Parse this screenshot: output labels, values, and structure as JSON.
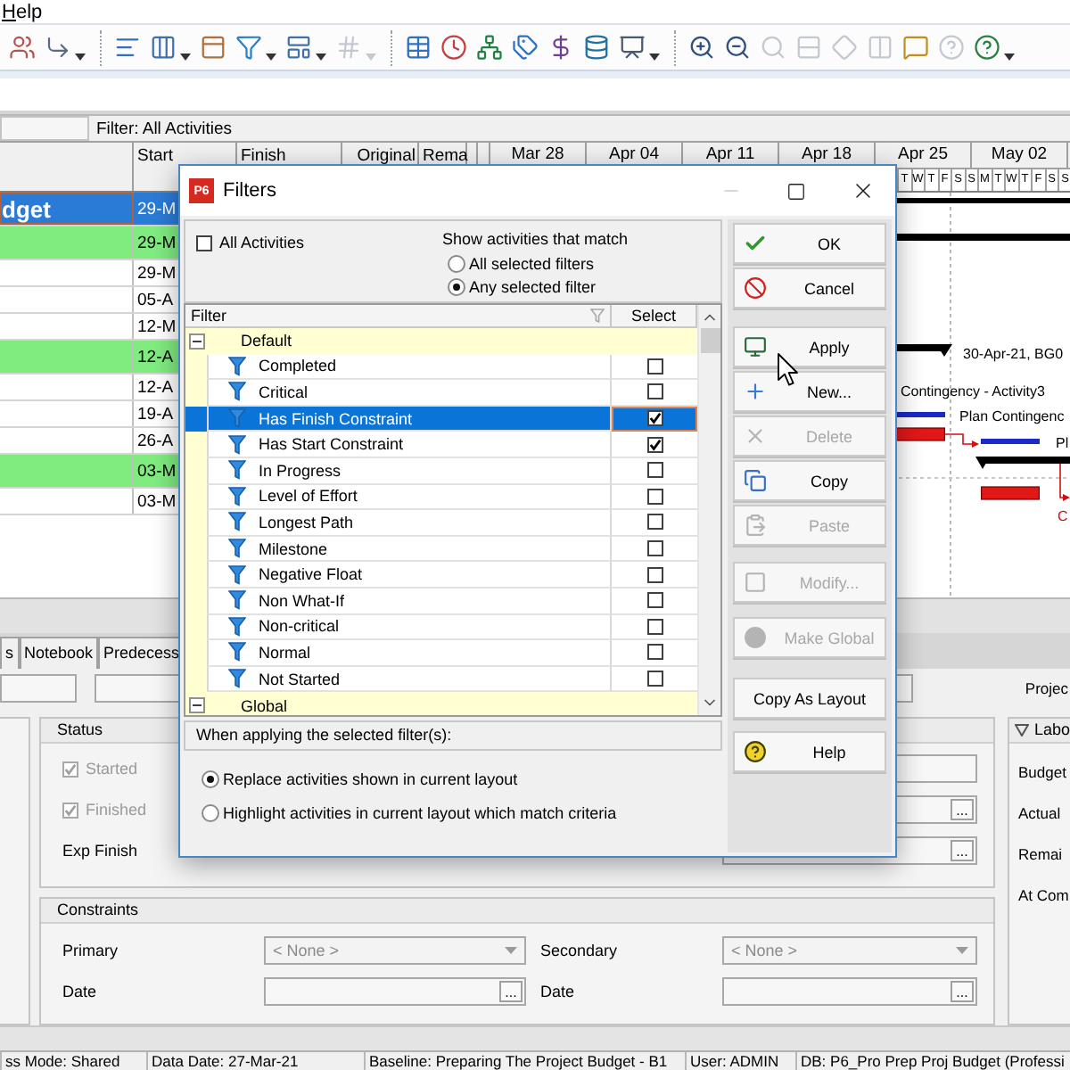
{
  "menu_bar": {
    "items": [
      {
        "label": "Help"
      }
    ]
  },
  "toolbar": {
    "items": [
      {
        "kind": "button",
        "disabled": false,
        "dropdown": false
      },
      {
        "kind": "button",
        "disabled": false,
        "dropdown": true
      },
      {
        "kind": "separator"
      },
      {
        "kind": "button",
        "disabled": false,
        "dropdown": false
      },
      {
        "kind": "button",
        "disabled": false,
        "dropdown": true
      },
      {
        "kind": "button",
        "disabled": false,
        "dropdown": false
      },
      {
        "kind": "button",
        "disabled": false,
        "dropdown": true
      },
      {
        "kind": "button",
        "disabled": false,
        "dropdown": true
      },
      {
        "kind": "button",
        "disabled": true,
        "dropdown": true
      },
      {
        "kind": "separator"
      },
      {
        "kind": "button",
        "disabled": false,
        "dropdown": false
      },
      {
        "kind": "button",
        "disabled": false,
        "dropdown": false
      },
      {
        "kind": "button",
        "disabled": false,
        "dropdown": false
      },
      {
        "kind": "button",
        "disabled": false,
        "dropdown": false
      },
      {
        "kind": "button",
        "disabled": false,
        "dropdown": false
      },
      {
        "kind": "button",
        "disabled": false,
        "dropdown": false
      },
      {
        "kind": "button",
        "disabled": false,
        "dropdown": true
      },
      {
        "kind": "separator"
      },
      {
        "kind": "button",
        "disabled": false,
        "dropdown": false
      },
      {
        "kind": "button",
        "disabled": false,
        "dropdown": false
      },
      {
        "kind": "button",
        "disabled": true,
        "dropdown": false
      },
      {
        "kind": "button",
        "disabled": true,
        "dropdown": false
      },
      {
        "kind": "button",
        "disabled": true,
        "dropdown": false
      },
      {
        "kind": "button",
        "disabled": true,
        "dropdown": false
      },
      {
        "kind": "button",
        "disabled": false,
        "dropdown": false
      },
      {
        "kind": "button",
        "disabled": true,
        "dropdown": false
      },
      {
        "kind": "button",
        "disabled": false,
        "dropdown": true
      }
    ]
  },
  "filter_bar": {
    "label": "Filter: All Activities"
  },
  "activity_table": {
    "columns": [
      {
        "label": "Start"
      },
      {
        "label": "Finish"
      },
      {
        "label": "Original"
      },
      {
        "label": "Rema"
      }
    ],
    "timescale": {
      "weeks": [
        "Mar 28",
        "Apr 04",
        "Apr 11",
        "Apr 18",
        "Apr 25",
        "May 02"
      ],
      "days": [
        "T",
        "W",
        "T",
        "F",
        "S",
        "S",
        "M",
        "T",
        "W",
        "T",
        "F",
        "S",
        "S"
      ]
    },
    "rows": [
      {
        "kind": "project",
        "name": "dget",
        "start": "29-M",
        "selected": true
      },
      {
        "kind": "wbs",
        "start": "29-M",
        "selected": false
      },
      {
        "kind": "activity",
        "start": "29-M",
        "selected": false
      },
      {
        "kind": "activity",
        "start": "05-A",
        "selected": false
      },
      {
        "kind": "activity",
        "start": "12-M",
        "selected": false
      },
      {
        "kind": "wbs",
        "start": "12-A",
        "selected": false
      },
      {
        "kind": "activity",
        "start": "12-A",
        "selected": false
      },
      {
        "kind": "activity",
        "start": "19-A",
        "selected": false
      },
      {
        "kind": "activity",
        "start": "26-A",
        "selected": false
      },
      {
        "kind": "wbs",
        "start": "03-M",
        "selected": false
      },
      {
        "kind": "activity",
        "start": "03-M",
        "selected": false
      }
    ]
  },
  "gantt": {
    "labels": [
      {
        "text": "30-Apr-21, BG0",
        "critical": false
      },
      {
        "text": "Contingency - Activity3",
        "critical": false
      },
      {
        "text": "Plan Contingenc",
        "critical": false
      },
      {
        "text": "Pl",
        "critical": false
      },
      {
        "text": "C",
        "critical": true
      }
    ]
  },
  "filters_dialog": {
    "icon_text": "P6",
    "title": "Filters",
    "all_activities": {
      "label": "All Activities",
      "checked": false
    },
    "match": {
      "label": "Show activities that match",
      "options": [
        {
          "label": "All selected filters",
          "selected": false
        },
        {
          "label": "Any selected filter",
          "selected": true
        }
      ]
    },
    "filter_table": {
      "columns": [
        {
          "label": "Filter"
        },
        {
          "label": "Select"
        }
      ],
      "groups": [
        {
          "label": "Default",
          "expanded": true,
          "children": [
            {
              "label": "Completed",
              "checked": false,
              "selected": false
            },
            {
              "label": "Critical",
              "checked": false,
              "selected": false
            },
            {
              "label": "Has Finish Constraint",
              "checked": true,
              "selected": true
            },
            {
              "label": "Has Start Constraint",
              "checked": true,
              "selected": false
            },
            {
              "label": "In Progress",
              "checked": false,
              "selected": false
            },
            {
              "label": "Level of Effort",
              "checked": false,
              "selected": false
            },
            {
              "label": "Longest Path",
              "checked": false,
              "selected": false
            },
            {
              "label": "Milestone",
              "checked": false,
              "selected": false
            },
            {
              "label": "Negative Float",
              "checked": false,
              "selected": false
            },
            {
              "label": "Non What-If",
              "checked": false,
              "selected": false
            },
            {
              "label": "Non-critical",
              "checked": false,
              "selected": false
            },
            {
              "label": "Normal",
              "checked": false,
              "selected": false
            },
            {
              "label": "Not Started",
              "checked": false,
              "selected": false
            }
          ]
        },
        {
          "label": "Global",
          "expanded": true
        }
      ]
    },
    "apply_mode": {
      "label": "When applying the selected filter(s):",
      "options": [
        {
          "label": "Replace activities shown in current layout",
          "selected": true
        },
        {
          "label": "Highlight activities in current layout which match criteria",
          "selected": false
        }
      ]
    },
    "buttons": [
      {
        "label": "OK",
        "disabled": false
      },
      {
        "label": "Cancel",
        "disabled": false
      },
      {
        "label": "Apply",
        "disabled": false
      },
      {
        "label": "New...",
        "disabled": false
      },
      {
        "label": "Delete",
        "disabled": true
      },
      {
        "label": "Copy",
        "disabled": false
      },
      {
        "label": "Paste",
        "disabled": true
      },
      {
        "label": "Modify...",
        "disabled": true
      },
      {
        "label": "Make Global",
        "disabled": true
      },
      {
        "label": "Copy As Layout",
        "disabled": false
      },
      {
        "label": "Help",
        "disabled": false
      }
    ]
  },
  "detail_panel": {
    "tabs": [
      {
        "label": "s",
        "selected": false
      },
      {
        "label": "Notebook",
        "selected": false
      },
      {
        "label": "Predecess",
        "selected": false
      }
    ],
    "header_label": "Projec",
    "status": {
      "title": "Status",
      "checks": [
        {
          "label": "Started",
          "checked": true,
          "disabled": true
        },
        {
          "label": "Finished",
          "checked": true,
          "disabled": true
        }
      ],
      "exp_finish_label": "Exp Finish",
      "fields": [
        {
          "kind": "text"
        },
        {
          "kind": "date",
          "button": "..."
        },
        {
          "kind": "date",
          "button": "..."
        }
      ]
    },
    "constraints": {
      "title": "Constraints",
      "left": [
        {
          "kind": "dropdown",
          "label": "Primary",
          "value": "< None >",
          "disabled": true
        },
        {
          "kind": "date",
          "label": "Date",
          "button": "..."
        }
      ],
      "right": [
        {
          "kind": "dropdown",
          "label": "Secondary",
          "value": "< None >",
          "disabled": true
        },
        {
          "kind": "date",
          "label": "Date",
          "button": "..."
        }
      ]
    },
    "labor": {
      "title": "Labo",
      "expanded": true,
      "labels": [
        "Budget",
        "Actual",
        "Remai",
        "At Com"
      ]
    }
  },
  "status_bar": {
    "items": [
      "ss Mode: Shared",
      "Data Date: 27-Mar-21",
      "Baseline: Preparing The Project Budget - B1",
      "User: ADMIN",
      "DB: P6_Pro Prep Proj Budget (Professi"
    ]
  }
}
